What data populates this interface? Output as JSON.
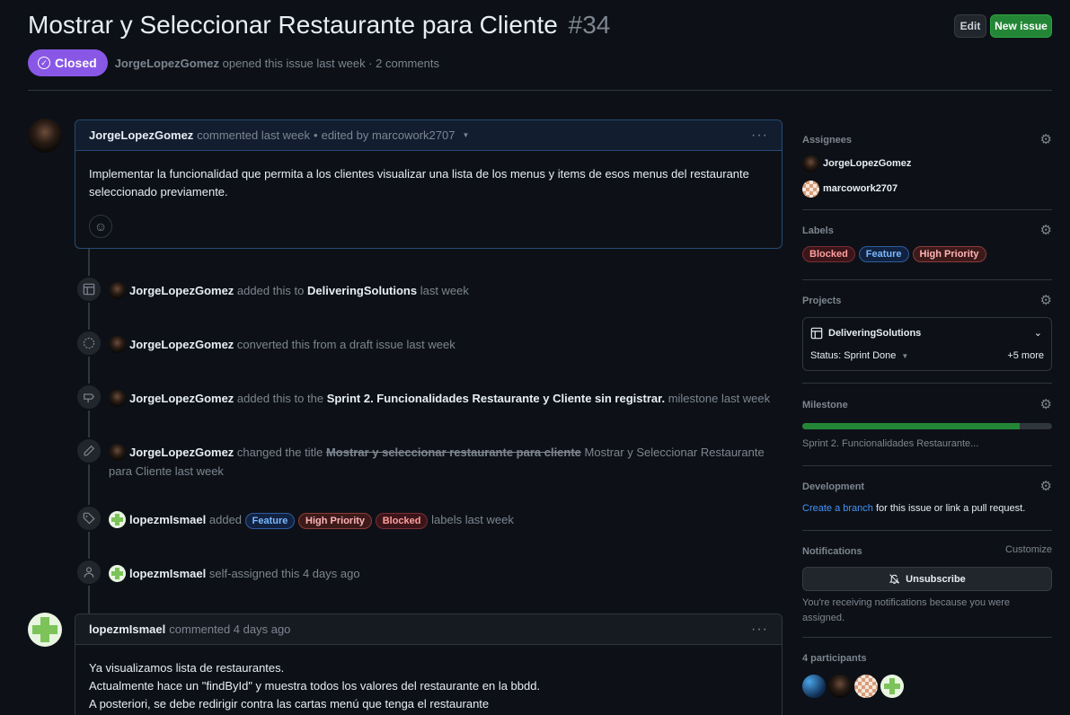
{
  "issue": {
    "title": "Mostrar y Seleccionar Restaurante para Cliente",
    "number": "#34",
    "state": "Closed",
    "author": "JorgeLopezGomez",
    "meta": "opened this issue last week · 2 comments"
  },
  "header": {
    "edit_label": "Edit",
    "new_issue_label": "New issue"
  },
  "comments": [
    {
      "author": "JorgeLopezGomez",
      "action": "commented last week",
      "bullet": "•",
      "edited": "edited by marcowork2707",
      "body": "Implementar la funcionalidad que permita a los clientes visualizar una lista de los menus y items de esos menus del restaurante seleccionado previamente."
    },
    {
      "author": "lopezmIsmael",
      "action": "commented 4 days ago",
      "body_lines": [
        "Ya visualizamos lista de restaurantes.",
        "Actualmente hace un \"findById\" y muestra todos los valores del restaurante en la bbdd.",
        "A posteriori, se debe redirigir contra las cartas menú que tenga el restaurante"
      ]
    }
  ],
  "events": [
    {
      "icon": "table-icon",
      "actor": "JorgeLopezGomez",
      "pre": "added this to",
      "target": "DeliveringSolutions",
      "post": "last week"
    },
    {
      "icon": "dashed-circle-icon",
      "actor": "JorgeLopezGomez",
      "pre": "converted this from a draft issue last week"
    },
    {
      "icon": "milestone-icon",
      "actor": "JorgeLopezGomez",
      "pre": "added this to the",
      "target": "Sprint 2. Funcionalidades Restaurante y Cliente sin registrar.",
      "post": "milestone last week"
    },
    {
      "icon": "pencil-icon",
      "actor": "JorgeLopezGomez",
      "pre": "changed the title",
      "old": "Mostrar y seleccionar restaurante para cliente",
      "new": "Mostrar y Seleccionar Restaurante para Cliente",
      "post": "last week"
    },
    {
      "icon": "tag-icon",
      "actor": "lopezmIsmael",
      "pre": "added",
      "labels": [
        "Feature",
        "High Priority",
        "Blocked"
      ],
      "post": "labels last week"
    },
    {
      "icon": "person-icon",
      "actor": "lopezmIsmael",
      "pre": "self-assigned this 4 days ago"
    }
  ],
  "sidebar": {
    "assignees": {
      "title": "Assignees",
      "items": [
        "JorgeLopezGomez",
        "marcowork2707"
      ]
    },
    "labels": {
      "title": "Labels",
      "items": [
        "Blocked",
        "Feature",
        "High Priority"
      ]
    },
    "projects": {
      "title": "Projects",
      "name": "DeliveringSolutions",
      "status": "Status: Sprint Done",
      "more": "+5 more"
    },
    "milestone": {
      "title": "Milestone",
      "name": "Sprint 2. Funcionalidades Restaurante...",
      "progress": 0.87
    },
    "development": {
      "title": "Development",
      "link": "Create a branch",
      "text": "for this issue or link a pull request."
    },
    "notifications": {
      "title": "Notifications",
      "customize": "Customize",
      "button": "Unsubscribe",
      "text": "You're receiving notifications because you were assigned."
    },
    "participants": {
      "title": "4 participants"
    }
  },
  "colors": {
    "closed": "#8957e5",
    "new_issue": "#238636",
    "link": "#4493f8"
  }
}
